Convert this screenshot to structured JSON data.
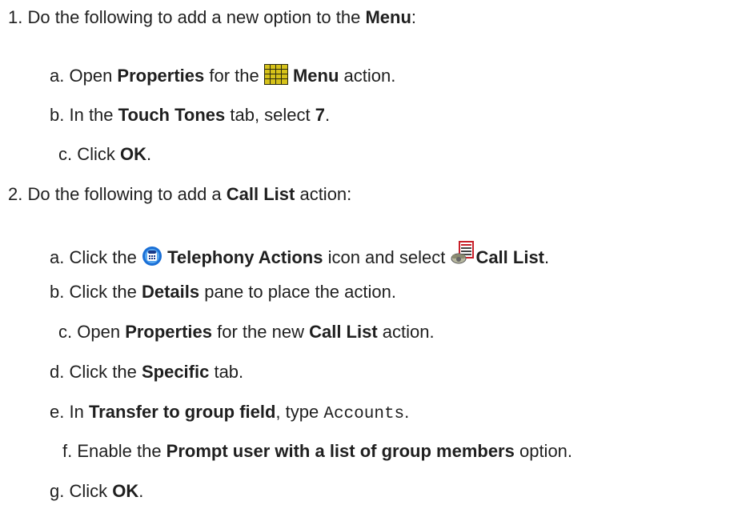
{
  "steps": [
    {
      "number": "1.",
      "text_before": "Do the following to add a new option to the ",
      "bold": "Menu",
      "text_after": ":",
      "substeps": [
        {
          "letter": "a.",
          "t1": "Open ",
          "b1": "Properties",
          "t2": " for the ",
          "icon": "menu-grid-icon",
          "b2": "Menu",
          "t3": " action."
        },
        {
          "letter": "b.",
          "t1": "In the ",
          "b1": "Touch Tones",
          "t2": " tab, select ",
          "b2": "7",
          "t3": "."
        },
        {
          "letter": "c.",
          "t1": "Click ",
          "b1": "OK",
          "t2": "."
        }
      ]
    },
    {
      "number": "2.",
      "text_before": "Do the following to add a ",
      "bold": "Call List",
      "text_after": " action:",
      "substeps": [
        {
          "letter": "a.",
          "t1": "Click the ",
          "icon1": "telephony-actions-icon",
          "b1": "Telephony Actions",
          "t2": " icon and select ",
          "icon2": "call-list-icon",
          "b2": "Call List",
          "t3": "."
        },
        {
          "letter": "b.",
          "t1": "Click the ",
          "b1": "Details",
          "t2": " pane to place the action."
        },
        {
          "letter": "c.",
          "t1": "Open ",
          "b1": "Properties",
          "t2": " for the new ",
          "b2": "Call List",
          "t3": " action."
        },
        {
          "letter": "d.",
          "t1": "Click the ",
          "b1": "Specific",
          "t2": " tab."
        },
        {
          "letter": "e.",
          "t1": "In ",
          "b1": "Transfer to group field",
          "t2": ", type ",
          "code": "Accounts",
          "t3": "."
        },
        {
          "letter": "f.",
          "t1": "Enable the ",
          "b1": "Prompt user with a list of group members",
          "t2": " option."
        },
        {
          "letter": "g.",
          "t1": "Click ",
          "b1": "OK",
          "t2": "."
        }
      ]
    }
  ],
  "colors": {
    "text": "#1f1f1f",
    "menu_icon": "#d6c21a",
    "telephony_icon": "#1a6fd6",
    "call_list_icon": "#c8202a"
  }
}
